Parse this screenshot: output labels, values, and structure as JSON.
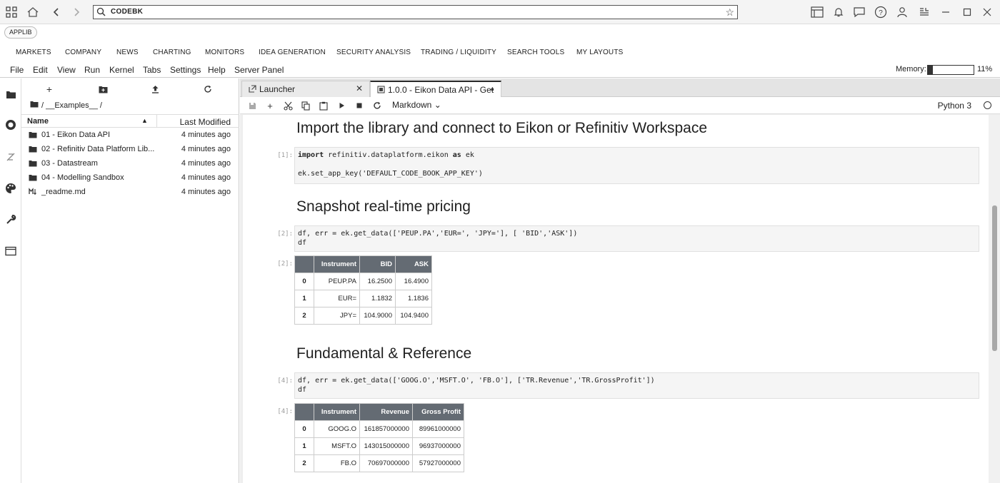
{
  "browser": {
    "address_text": "CODEBK",
    "icons": [
      "apps-grid-icon",
      "home-icon",
      "back-arrow-icon",
      "forward-arrow-icon",
      "search-icon",
      "star-icon",
      "panel-icon",
      "bell-icon",
      "chat-icon",
      "help-icon",
      "user-icon",
      "list-icon",
      "minimize-icon",
      "maximize-icon",
      "close-icon"
    ]
  },
  "applib": {
    "label": "APPLIB"
  },
  "product_menu": [
    "MARKETS",
    "COMPANY",
    "NEWS",
    "CHARTING",
    "MONITORS",
    "IDEA GENERATION",
    "SECURITY ANALYSIS",
    "TRADING / LIQUIDITY",
    "SEARCH TOOLS",
    "MY LAYOUTS"
  ],
  "jupyter_menu": [
    "File",
    "Edit",
    "View",
    "Run",
    "Kernel",
    "Tabs",
    "Settings",
    "Help",
    "Server Panel"
  ],
  "memory": {
    "label": "Memory:",
    "percent_text": "11%",
    "fraction": 0.11
  },
  "activity_bar": [
    "folder-icon",
    "running-icon",
    "commands-icon",
    "palette-icon",
    "wrench-icon",
    "tabs-icon"
  ],
  "file_browser": {
    "toolbar_icons": [
      "new-launcher-icon",
      "new-folder-icon",
      "upload-icon",
      "refresh-icon"
    ],
    "breadcrumb": "/ __Examples__ /",
    "columns": {
      "name": "Name",
      "modified": "Last Modified"
    },
    "items": [
      {
        "name": "01 - Eikon Data API",
        "modified": "4 minutes ago",
        "type": "folder"
      },
      {
        "name": "02 - Refinitiv Data Platform Lib...",
        "modified": "4 minutes ago",
        "type": "folder"
      },
      {
        "name": "03 - Datastream",
        "modified": "4 minutes ago",
        "type": "folder"
      },
      {
        "name": "04 - Modelling Sandbox",
        "modified": "4 minutes ago",
        "type": "folder"
      },
      {
        "name": "_readme.md",
        "modified": "4 minutes ago",
        "type": "markdown"
      }
    ]
  },
  "tabs": [
    {
      "label": "Launcher",
      "active": false
    },
    {
      "label": "1.0.0 - Eikon Data API - Get",
      "active": true
    }
  ],
  "notebook_toolbar": {
    "cell_type": "Markdown",
    "kernel": "Python 3"
  },
  "notebook": {
    "heading1": "Import the library and connect to Eikon or Refinitiv Workspace",
    "heading2": "Snapshot real-time pricing",
    "heading3": "Fundamental & Reference",
    "cell1": {
      "prompt": "[1]:",
      "import_kw": "import",
      "module": "refinitiv.dataplatform.eikon",
      "as_kw": "as",
      "alias": "ek",
      "line2": "ek.set_app_key('DEFAULT_CODE_BOOK_APP_KEY')"
    },
    "cell2": {
      "prompt": "[2]:",
      "line1": "df, err = ek.get_data(['PEUP.PA','EUR=', 'JPY='], [ 'BID','ASK'])",
      "line2": "df",
      "out_prompt": "[2]:",
      "columns": [
        "",
        "Instrument",
        "BID",
        "ASK"
      ],
      "rows": [
        [
          "0",
          "PEUP.PA",
          "16.2500",
          "16.4900"
        ],
        [
          "1",
          "EUR=",
          "1.1832",
          "1.1836"
        ],
        [
          "2",
          "JPY=",
          "104.9000",
          "104.9400"
        ]
      ]
    },
    "cell3": {
      "prompt": "[4]:",
      "line1": "df, err = ek.get_data(['GOOG.O','MSFT.O', 'FB.O'], ['TR.Revenue','TR.GrossProfit'])",
      "line2": "df",
      "out_prompt": "[4]:",
      "columns": [
        "",
        "Instrument",
        "Revenue",
        "Gross Profit"
      ],
      "rows": [
        [
          "0",
          "GOOG.O",
          "161857000000",
          "89961000000"
        ],
        [
          "1",
          "MSFT.O",
          "143015000000",
          "96937000000"
        ],
        [
          "2",
          "FB.O",
          "70697000000",
          "57927000000"
        ]
      ]
    }
  }
}
